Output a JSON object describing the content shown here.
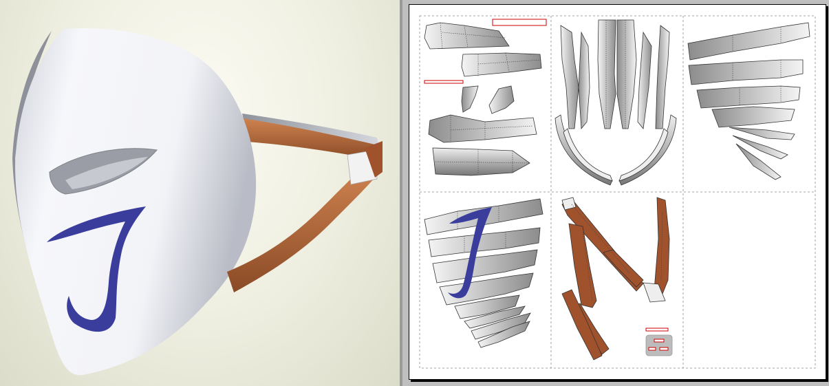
{
  "app": {
    "panes": [
      "3d-view",
      "2d-layout"
    ]
  },
  "model_3d": {
    "subject": "white-mask-with-strap",
    "emblem_letter": "J",
    "colors": {
      "mask_white": "#f2f3f7",
      "mask_shadow": "#9a9ea8",
      "emblem_blue": "#3a3d9c",
      "strap_brown": "#b86a3c",
      "strap_dark": "#7c4222",
      "background": "#eeeee0"
    }
  },
  "layout_2d": {
    "colors": {
      "page_border": "#000000",
      "tile_guide": "#888888",
      "part_outline": "#333333",
      "label_marker": "#cc0000",
      "brown_part": "#a0522d",
      "gray_part": "#d0d0d0"
    },
    "emblem_letter": "J",
    "parts": [
      {
        "name": "mask-upper-plates",
        "tile": "top-left"
      },
      {
        "name": "mask-face-strips",
        "tile": "top-center"
      },
      {
        "name": "mask-side-plates",
        "tile": "top-right"
      },
      {
        "name": "mask-emblem-plates",
        "tile": "bottom-left"
      },
      {
        "name": "strap-pieces",
        "tile": "bottom-center"
      }
    ]
  }
}
